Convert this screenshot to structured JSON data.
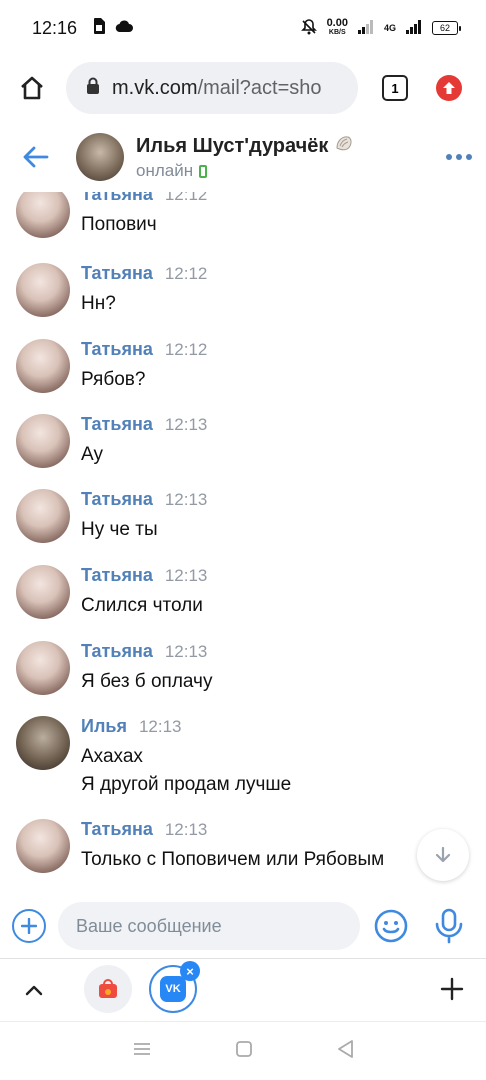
{
  "status_bar": {
    "time": "12:16",
    "speed_value": "0.00",
    "speed_unit": "KB/S",
    "network": "4G",
    "battery": "62"
  },
  "browser": {
    "url_host": "m.vk.com",
    "url_path": "/mail?act=sho",
    "tab_count": "1"
  },
  "chat": {
    "name": "Илья Шуст'дурачёк",
    "status": "онлайн"
  },
  "messages": [
    {
      "author": "Татьяна",
      "time": "12:12",
      "lines": [
        "Попович"
      ],
      "avatar": "tatyana"
    },
    {
      "author": "Татьяна",
      "time": "12:12",
      "lines": [
        "Нн?"
      ],
      "avatar": "tatyana"
    },
    {
      "author": "Татьяна",
      "time": "12:12",
      "lines": [
        "Рябов?"
      ],
      "avatar": "tatyana"
    },
    {
      "author": "Татьяна",
      "time": "12:13",
      "lines": [
        "Ау"
      ],
      "avatar": "tatyana"
    },
    {
      "author": "Татьяна",
      "time": "12:13",
      "lines": [
        "Ну че ты"
      ],
      "avatar": "tatyana"
    },
    {
      "author": "Татьяна",
      "time": "12:13",
      "lines": [
        "Слился чтоли"
      ],
      "avatar": "tatyana"
    },
    {
      "author": "Татьяна",
      "time": "12:13",
      "lines": [
        "Я без б оплачу"
      ],
      "avatar": "tatyana"
    },
    {
      "author": "Илья",
      "time": "12:13",
      "lines": [
        "Ахахах",
        "Я другой продам лучше"
      ],
      "avatar": "ilya"
    },
    {
      "author": "Татьяна",
      "time": "12:13",
      "lines": [
        "Только с Поповичем или Рябовым"
      ],
      "avatar": "tatyana"
    }
  ],
  "composer": {
    "placeholder": "Ваше сообщение",
    "value": ""
  },
  "tab_strip": {
    "vk_logo": "VK",
    "close": "×"
  },
  "colors": {
    "accent": "#5181b8",
    "vk_blue": "#2787f5",
    "online_green": "#4bb34b",
    "update_red": "#e53935"
  }
}
